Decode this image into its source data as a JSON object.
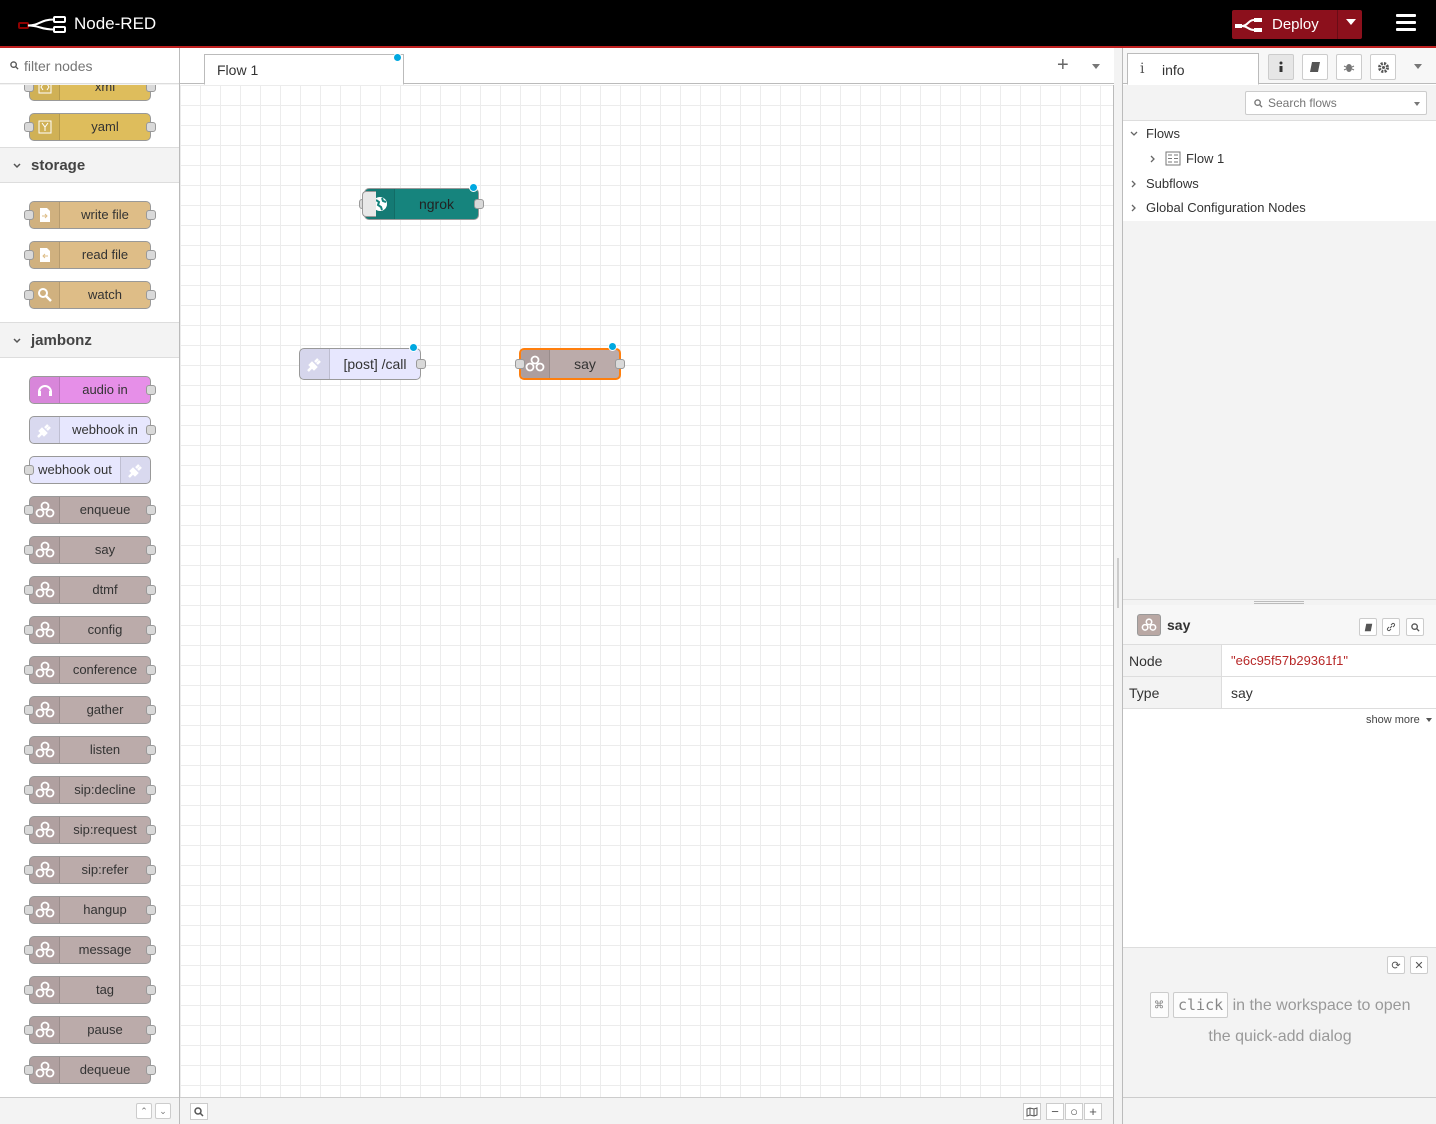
{
  "header": {
    "title": "Node-RED",
    "deploy_label": "Deploy",
    "colors": {
      "background": "#000000",
      "deploy": "#8c101c",
      "accent_line": "#c02020"
    }
  },
  "palette": {
    "filter_placeholder": "filter nodes",
    "parsers_tail": [
      {
        "label": "xml",
        "icon": "xml-icon",
        "color": "#debd5c"
      },
      {
        "label": "yaml",
        "icon": "yaml-icon",
        "color": "#debd5c"
      }
    ],
    "categories": [
      {
        "label": "storage",
        "nodes": [
          {
            "label": "write file",
            "icon": "file-out-icon",
            "color": "#debd87"
          },
          {
            "label": "read file",
            "icon": "file-in-icon",
            "color": "#debd87"
          },
          {
            "label": "watch",
            "icon": "watch-icon",
            "color": "#debd87"
          }
        ]
      },
      {
        "label": "jambonz",
        "nodes": [
          {
            "label": "audio in",
            "icon": "headset-icon",
            "color": "#e68fe8"
          },
          {
            "label": "webhook in",
            "icon": "plug-icon",
            "color": "#e7e7fe"
          },
          {
            "label": "webhook out",
            "icon": "plug-icon",
            "color": "#e7e7fe"
          },
          {
            "label": "enqueue",
            "icon": "jambonz-icon",
            "color": "#bbabaa"
          },
          {
            "label": "say",
            "icon": "jambonz-icon",
            "color": "#bbabaa"
          },
          {
            "label": "dtmf",
            "icon": "jambonz-icon",
            "color": "#bbabaa"
          },
          {
            "label": "config",
            "icon": "jambonz-icon",
            "color": "#bbabaa"
          },
          {
            "label": "conference",
            "icon": "jambonz-icon",
            "color": "#bbabaa"
          },
          {
            "label": "gather",
            "icon": "jambonz-icon",
            "color": "#bbabaa"
          },
          {
            "label": "listen",
            "icon": "jambonz-icon",
            "color": "#bbabaa"
          },
          {
            "label": "sip:decline",
            "icon": "jambonz-icon",
            "color": "#bbabaa"
          },
          {
            "label": "sip:request",
            "icon": "jambonz-icon",
            "color": "#bbabaa"
          },
          {
            "label": "sip:refer",
            "icon": "jambonz-icon",
            "color": "#bbabaa"
          },
          {
            "label": "hangup",
            "icon": "jambonz-icon",
            "color": "#bbabaa"
          },
          {
            "label": "message",
            "icon": "jambonz-icon",
            "color": "#bbabaa"
          },
          {
            "label": "tag",
            "icon": "jambonz-icon",
            "color": "#bbabaa"
          },
          {
            "label": "pause",
            "icon": "jambonz-icon",
            "color": "#bbabaa"
          },
          {
            "label": "dequeue",
            "icon": "jambonz-icon",
            "color": "#bbabaa"
          }
        ]
      }
    ]
  },
  "workspace": {
    "tabs": [
      {
        "label": "Flow 1"
      }
    ],
    "nodes": [
      {
        "label": "ngrok",
        "icon": "globe-icon",
        "color": "#16847d"
      },
      {
        "label": "[post] /call",
        "icon": "plug-icon",
        "color": "#e7e7fe"
      },
      {
        "label": "say",
        "icon": "jambonz-icon",
        "color": "#bbabaa",
        "selected": true
      }
    ]
  },
  "sidebar": {
    "tab_label": "info",
    "search_placeholder": "Search flows",
    "tree": {
      "flows": "Flows",
      "flow1": "Flow 1",
      "subflows": "Subflows",
      "global_config": "Global Configuration Nodes"
    },
    "selected": {
      "title": "say",
      "rows": [
        {
          "key": "Node",
          "value": "\"e6c95f57b29361f1\""
        },
        {
          "key": "Type",
          "value": "say"
        }
      ],
      "show_more": "show more"
    },
    "tip": {
      "key_symbol": "⌘",
      "key_word": "click",
      "text_a": " in the workspace to open",
      "text_b": "the quick-add dialog"
    }
  }
}
